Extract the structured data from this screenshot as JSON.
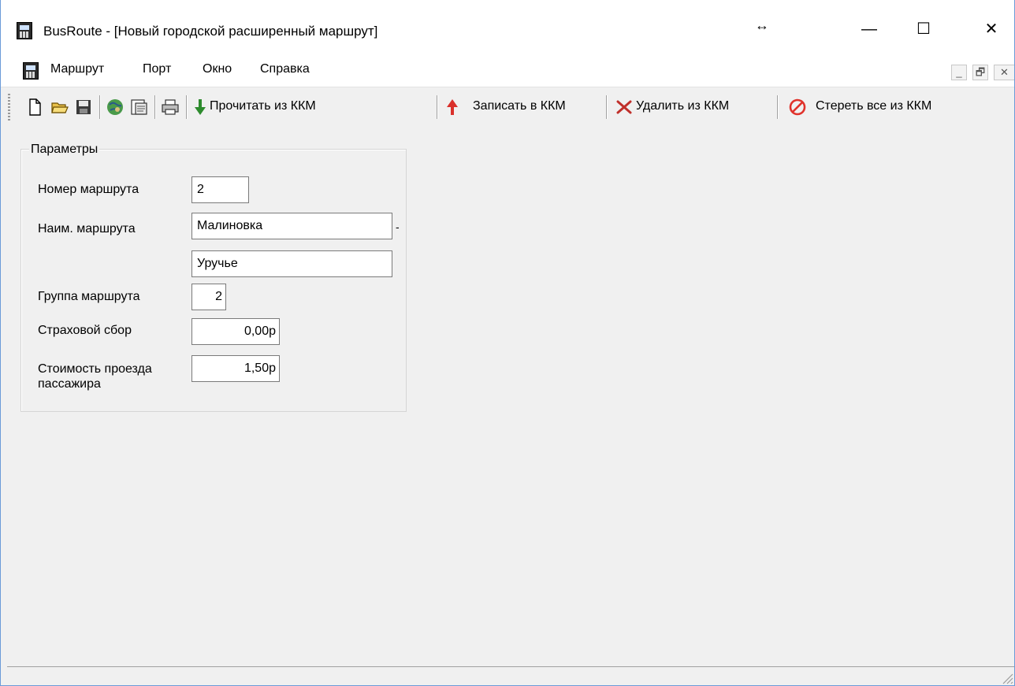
{
  "window": {
    "title": "BusRoute - [Новый городской расширенный маршрут]",
    "resize_glyph": "↔",
    "minimize_glyph": "—",
    "maximize_glyph": "☐",
    "close_glyph": "✕"
  },
  "menu": {
    "items": [
      "Маршрут",
      "Порт",
      "Окно",
      "Справка"
    ],
    "mdi_minimize": "_",
    "mdi_restore": "🗗",
    "mdi_close": "✕"
  },
  "toolbar": {
    "icons": [
      "new-document-icon",
      "open-folder-icon",
      "save-disk-icon",
      "route-map-icon",
      "properties-icon",
      "print-icon"
    ],
    "read_label": "Прочитать из ККМ",
    "write_label": "Записать в ККМ",
    "delete_label": "Удалить из ККМ",
    "erase_all_label": "Стереть все из ККМ"
  },
  "params": {
    "group_title": "Параметры",
    "route_number_label": "Номер маршрута",
    "route_number_value": "2",
    "route_name_label": "Наим. маршрута",
    "route_name_from": "Малиновка",
    "route_name_separator": "-",
    "route_name_to": "Уручье",
    "route_group_label": "Группа маршрута",
    "route_group_value": "2",
    "insurance_label": "Страховой сбор",
    "insurance_value": "0,00р",
    "fare_label_line1": "Стоимость проезда",
    "fare_label_line2": "пассажира",
    "fare_value": "1,50р"
  },
  "colors": {
    "read_arrow": "#2e8b2e",
    "write_arrow": "#d9302b",
    "delete_x": "#c0302b",
    "erase_circle": "#e0322b"
  }
}
